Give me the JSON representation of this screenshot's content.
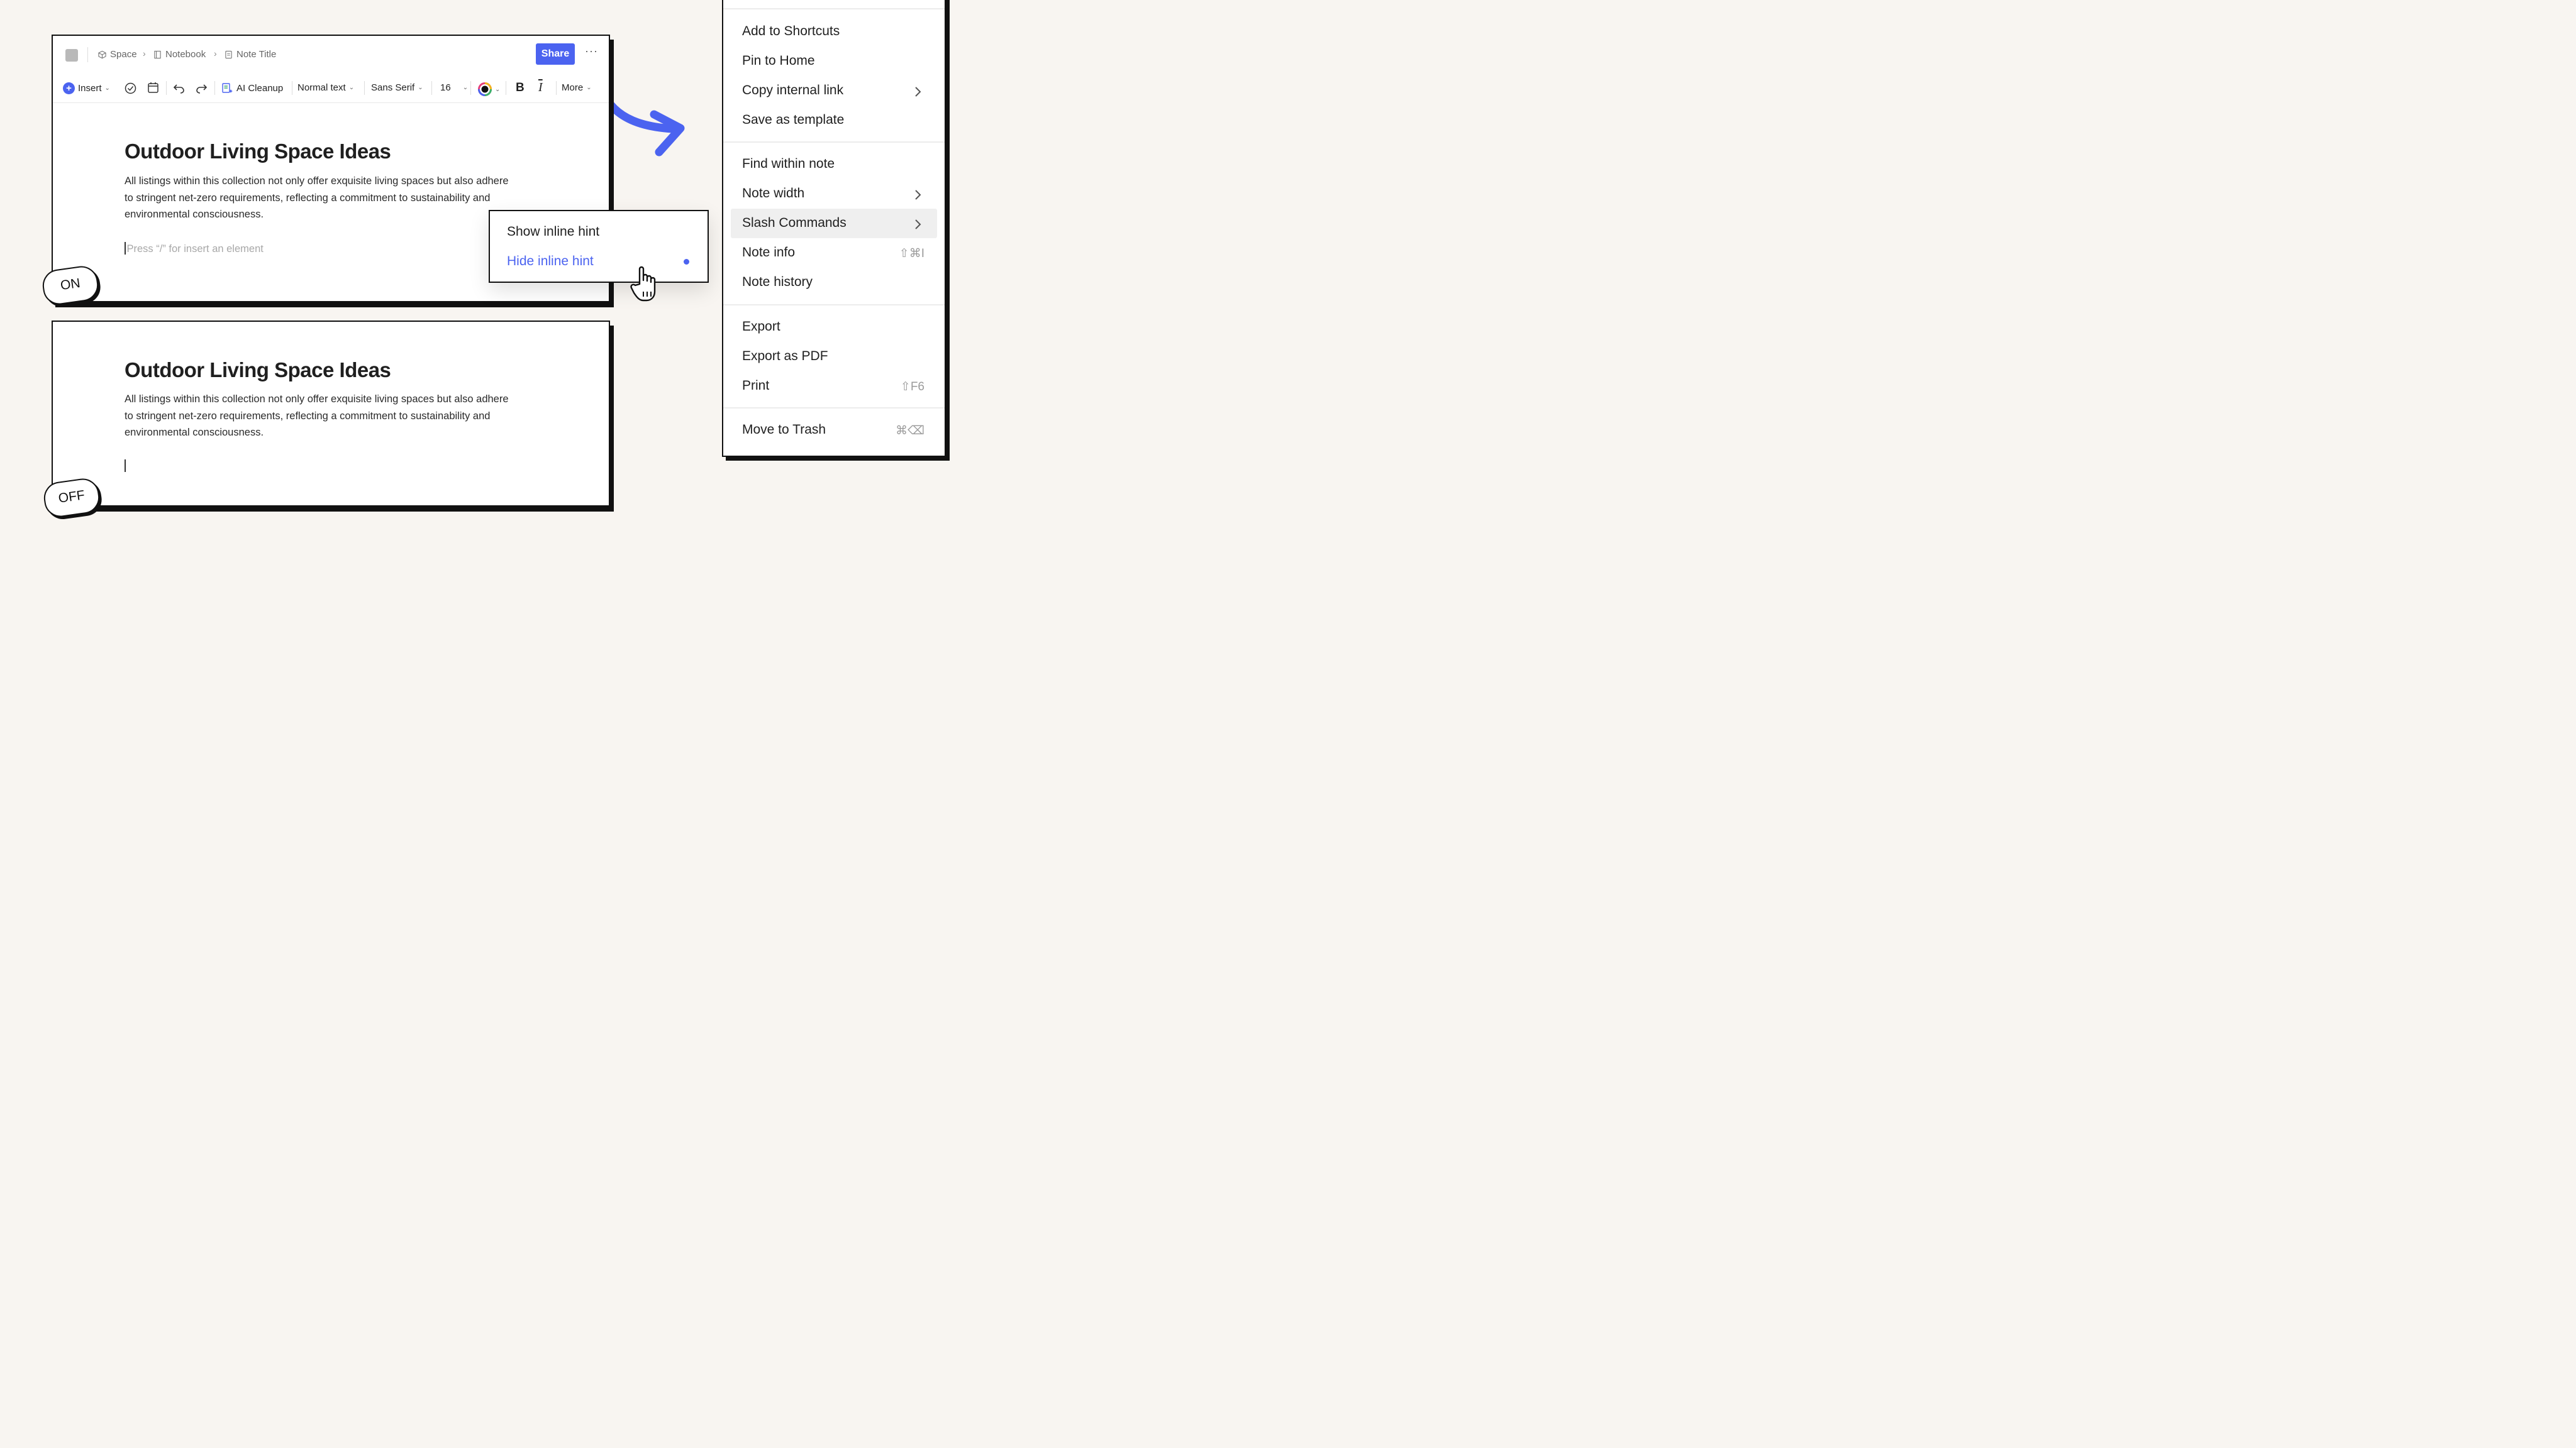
{
  "breadcrumb": {
    "space": "Space",
    "notebook": "Notebook",
    "note": "Note Title"
  },
  "header": {
    "share_label": "Share",
    "more_dots": "···"
  },
  "toolbar": {
    "insert": "Insert",
    "ai_cleanup": "AI Cleanup",
    "text_style": "Normal text",
    "font": "Sans Serif",
    "font_size": "16",
    "bold": "B",
    "italic": "I",
    "more": "More"
  },
  "note": {
    "title": "Outdoor Living Space Ideas",
    "body": "All listings within this collection not only offer exquisite living spaces but also adhere to stringent net-zero requirements, reflecting a commitment to sustainability and environmental consciousness.",
    "placeholder": "Press “/” for insert an element"
  },
  "labels": {
    "on": "ON",
    "off": "OFF"
  },
  "hint_menu": {
    "show": "Show inline hint",
    "hide": "Hide inline hint",
    "selected": "Hide inline hint"
  },
  "menu": {
    "add_shortcuts": "Add to Shortcuts",
    "pin_home": "Pin to Home",
    "copy_link": "Copy internal link",
    "save_template": "Save as template",
    "find": "Find within note",
    "note_width": "Note width",
    "slash": "Slash Commands",
    "note_info": "Note info",
    "note_info_sc": "⇧⌘I",
    "note_history": "Note history",
    "export": "Export",
    "export_pdf": "Export as PDF",
    "print": "Print",
    "print_sc": "⇧F6",
    "trash": "Move to Trash",
    "trash_sc": "⌘⌫"
  },
  "colors": {
    "accent": "#4b63f0",
    "background": "#f8f5f1",
    "border": "#111111"
  }
}
